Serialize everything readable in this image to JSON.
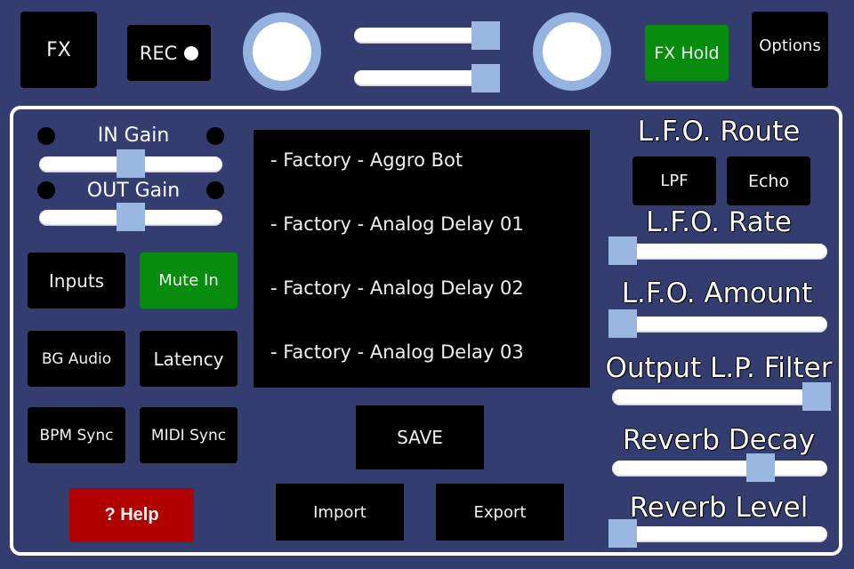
{
  "topbar": {
    "fx_label": "FX",
    "rec_label": "REC",
    "fx_hold_label": "FX Hold",
    "options_label": "Options",
    "top_slider_1_value": 1.0,
    "top_slider_2_value": 1.0
  },
  "gain": {
    "in_label": "IN Gain",
    "out_label": "OUT Gain",
    "in_value": 0.5,
    "out_value": 0.5
  },
  "left_buttons": {
    "inputs": "Inputs",
    "mute_in": "Mute In",
    "bg_audio": "BG Audio",
    "latency": "Latency",
    "bpm_sync": "BPM Sync",
    "midi_sync": "MIDI Sync",
    "help": "? Help"
  },
  "presets": {
    "items": [
      "- Factory - Aggro Bot",
      "- Factory - Analog Delay 01",
      "- Factory - Analog Delay 02",
      "- Factory - Analog Delay 03"
    ],
    "save_label": "SAVE",
    "import_label": "Import",
    "export_label": "Export"
  },
  "right_controls": {
    "lfo_route_label": "L.F.O. Route",
    "lpf_label": "LPF",
    "echo_label": "Echo",
    "lfo_rate_label": "L.F.O. Rate",
    "lfo_rate_value": 0.0,
    "lfo_amount_label": "L.F.O. Amount",
    "lfo_amount_value": 0.0,
    "output_lp_label": "Output L.P. Filter",
    "output_lp_value": 1.0,
    "reverb_decay_label": "Reverb Decay",
    "reverb_decay_value": 0.72,
    "reverb_level_label": "Reverb Level",
    "reverb_level_value": 0.0
  },
  "colors": {
    "background": "#333d70",
    "active_green": "#078c0e",
    "help_red": "#b00000",
    "slider_thumb": "#9ab7e2"
  }
}
